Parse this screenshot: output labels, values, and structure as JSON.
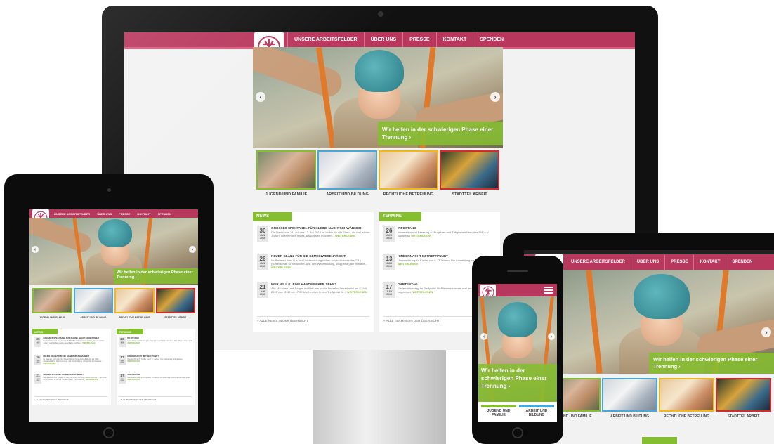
{
  "nav": {
    "items": [
      "UNSERE ARBEITSFELDER",
      "ÜBER UNS",
      "PRESSE",
      "KONTAKT",
      "SPENDEN"
    ]
  },
  "hero": {
    "caption": "Wir helfen in der schwierigen Phase einer Trennung ›",
    "caption_phone": "Wir helfen in der schwierigen Phase einer Trennung ›"
  },
  "categories": [
    {
      "label": "JUGEND UND FAMILIE",
      "color": "#85be30"
    },
    {
      "label": "ARBEIT UND BILDUNG",
      "color": "#4aa8d8"
    },
    {
      "label": "RECHTLICHE BETREUUNG",
      "color": "#f2b81a"
    },
    {
      "label": "STADTTEILARBEIT",
      "color": "#d62a2a"
    }
  ],
  "phone_categories": [
    "JUGEND UND FAMILIE",
    "ARBEIT UND BILDUNG"
  ],
  "news": {
    "title": "NEWS",
    "items": [
      {
        "day": "30",
        "month": "JUNI",
        "year": "2015",
        "title": "GROSSES SPEKTAKEL FÜR KLEINE NACHTSCHWÄRMER",
        "text": "Die Nacht vom 31. auf den 12. Juli 2015 ist Ichbin für alle Eltern, die mal wieder „ruhen“ oder einfach etwas ausschlafen möchten...",
        "more": "WEITERLESEN"
      },
      {
        "day": "26",
        "month": "JUNI",
        "year": "2015",
        "title": "NEUER GLANZ FÜR DIE GEMEINWESENARBEIT",
        "text": "Im Rahmen ihrer Aus- und Weiterbildung haben Auszubildende der GBA (Gesellschaft für berufliche Aus- und Weiterbildung, Wuppertal) auf Initiative...",
        "more": "WEITERLESEN"
      },
      {
        "day": "21",
        "month": "JUNI",
        "year": "2015",
        "title": "WER WILL KLEINE HANDWERKER SEHN?",
        "text": "Alle Mädchen und Jungen im Alter von sechs bis zehn Jahren sind am 5. Juli 2015 von 11.30 bis 17.30 Uhr herzlich in den Treffpunkt für...",
        "more": "WEITERLESEN"
      }
    ],
    "footer": "» ALLE NEWS IN DER ÜBERSICHT"
  },
  "termine": {
    "title": "TERMINE",
    "items": [
      {
        "day": "26",
        "month": "JUNI",
        "year": "2015",
        "title": "INFOSTAND",
        "text": "Information und Beratung zu Projekten und Tätigkeitsfeldern des SkF e.V. Wuppertal",
        "more": "WEITERLESEN"
      },
      {
        "day": "13",
        "month": "JULI",
        "year": "2015",
        "title": "KINDERNACHT IM TREFFPUNKT",
        "text": "Übernachtung für Kinder von 6 - 7 Jahren. Um Anmeldung wird gebeten.",
        "more": "WEITERLESEN"
      },
      {
        "day": "17",
        "month": "JULI",
        "year": "2015",
        "title": "GARTENTAG",
        "text": "Gartenaktionstag im Treffpunkt für Alleinerziehende und erschöpfende Lagerfeuer.",
        "more": "WEITERLESEN"
      }
    ],
    "footer": "» ALLE TERMINE IN DER ÜBERSICHT"
  },
  "colors": {
    "brand": "#b8375d",
    "accent": "#85be30"
  },
  "icons": {
    "prev": "chevron-left-icon",
    "next": "chevron-right-icon",
    "menu": "hamburger-menu-icon",
    "logo": "caritas-cross-logo"
  }
}
